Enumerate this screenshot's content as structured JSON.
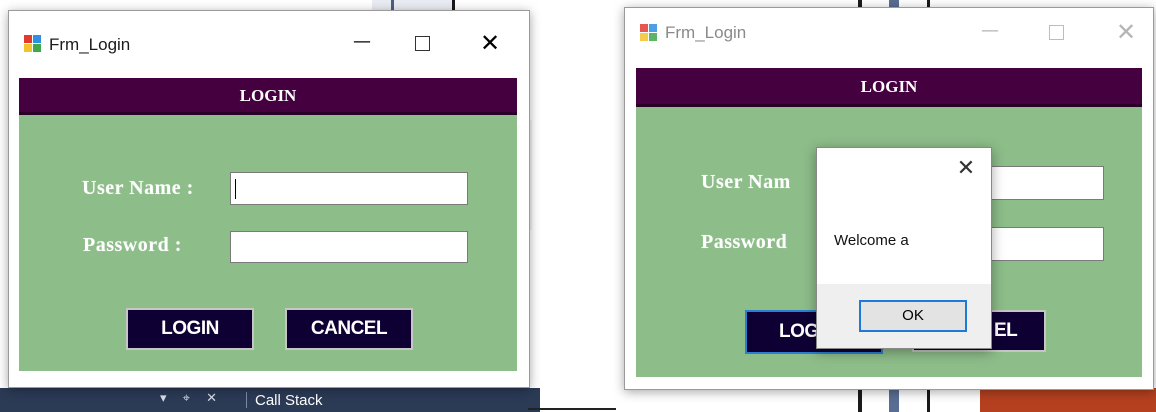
{
  "background": {
    "panel_tab": "Call Stack",
    "panel_tools": "▾ ⌖ ✕"
  },
  "window_left": {
    "title": "Frm_Login",
    "header": "LOGIN",
    "username_label": "User Name :",
    "password_label": "Password :",
    "username_value": "",
    "password_value": "",
    "login_button": "LOGIN",
    "cancel_button": "CANCEL",
    "controls": {
      "minimize": "—",
      "close": "✕"
    }
  },
  "window_right": {
    "title": "Frm_Login",
    "header": "LOGIN",
    "username_label": "User Nam",
    "password_label": "Password",
    "login_button": "LOG",
    "cancel_button": "EL",
    "controls": {
      "minimize": "—",
      "close": "✕"
    }
  },
  "message_box": {
    "message": "Welcome a",
    "ok_button": "OK",
    "close": "✕"
  },
  "colors": {
    "header_bg": "#45003f",
    "panel_bg": "#8dbd89",
    "button_bg": "#0e0033",
    "focus_border": "#1d7ad6"
  }
}
